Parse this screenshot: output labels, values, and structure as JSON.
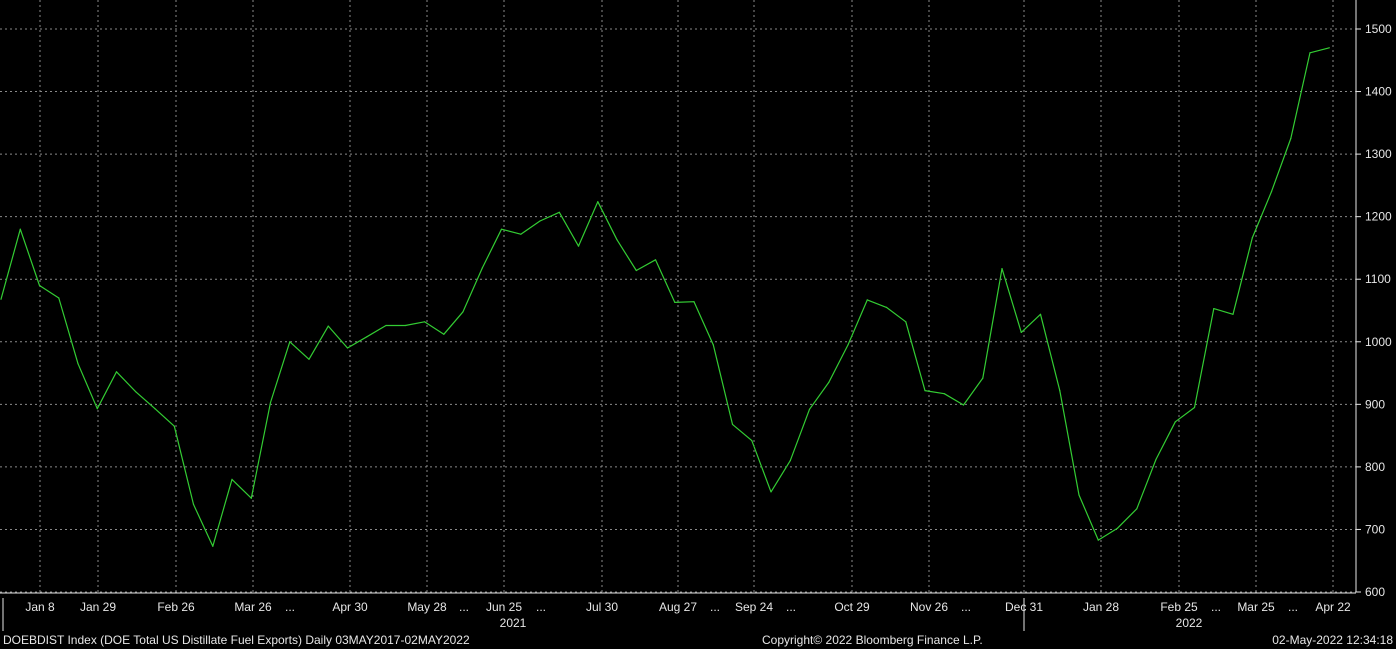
{
  "chart_data": {
    "type": "line",
    "title": "",
    "xlabel": "",
    "ylabel": "",
    "ylim": [
      600,
      1500
    ],
    "y_ticks": [
      600,
      700,
      800,
      900,
      1000,
      1100,
      1200,
      1300,
      1400,
      1500
    ],
    "x_tick_labels": [
      "Jan 8",
      "Jan 29",
      "Feb 26",
      "Mar 26",
      "...",
      "Apr 30",
      "May 28",
      "...",
      "Jun 25",
      "...",
      "Jul 30",
      "Aug 27",
      "...",
      "Sep 24",
      "...",
      "Oct 29",
      "Nov 26",
      "...",
      "Dec 31",
      "Jan 28",
      "Feb 25",
      "...",
      "Mar 25",
      "...",
      "Apr 22"
    ],
    "year_labels": [
      "2021",
      "2022"
    ],
    "grid": true,
    "line_color": "#33cc33",
    "series": [
      {
        "values": [
          1068,
          1180,
          1090,
          1070,
          965,
          893,
          952,
          920,
          893,
          865,
          740,
          673,
          780,
          750,
          903,
          1000,
          972,
          1025,
          990,
          1008,
          1026,
          1026,
          1032,
          1012,
          1048,
          1118,
          1180,
          1172,
          1193,
          1207,
          1153,
          1224,
          1163,
          1114,
          1131,
          1063,
          1064,
          995,
          868,
          842,
          760,
          810,
          892,
          935,
          995,
          1067,
          1055,
          1032,
          922,
          917,
          899,
          942,
          1117,
          1015,
          1044,
          922,
          755,
          683,
          702,
          733,
          812,
          872,
          895,
          1053,
          1044,
          1166,
          1240,
          1325,
          1462,
          1470
        ]
      }
    ]
  },
  "footer": {
    "left": "DOEBDIST Index (DOE Total US Distillate Fuel Exports)  Daily 03MAY2017-02MAY2022",
    "center": "Copyright© 2022 Bloomberg Finance L.P.",
    "right": "02-May-2022 12:34:18"
  }
}
